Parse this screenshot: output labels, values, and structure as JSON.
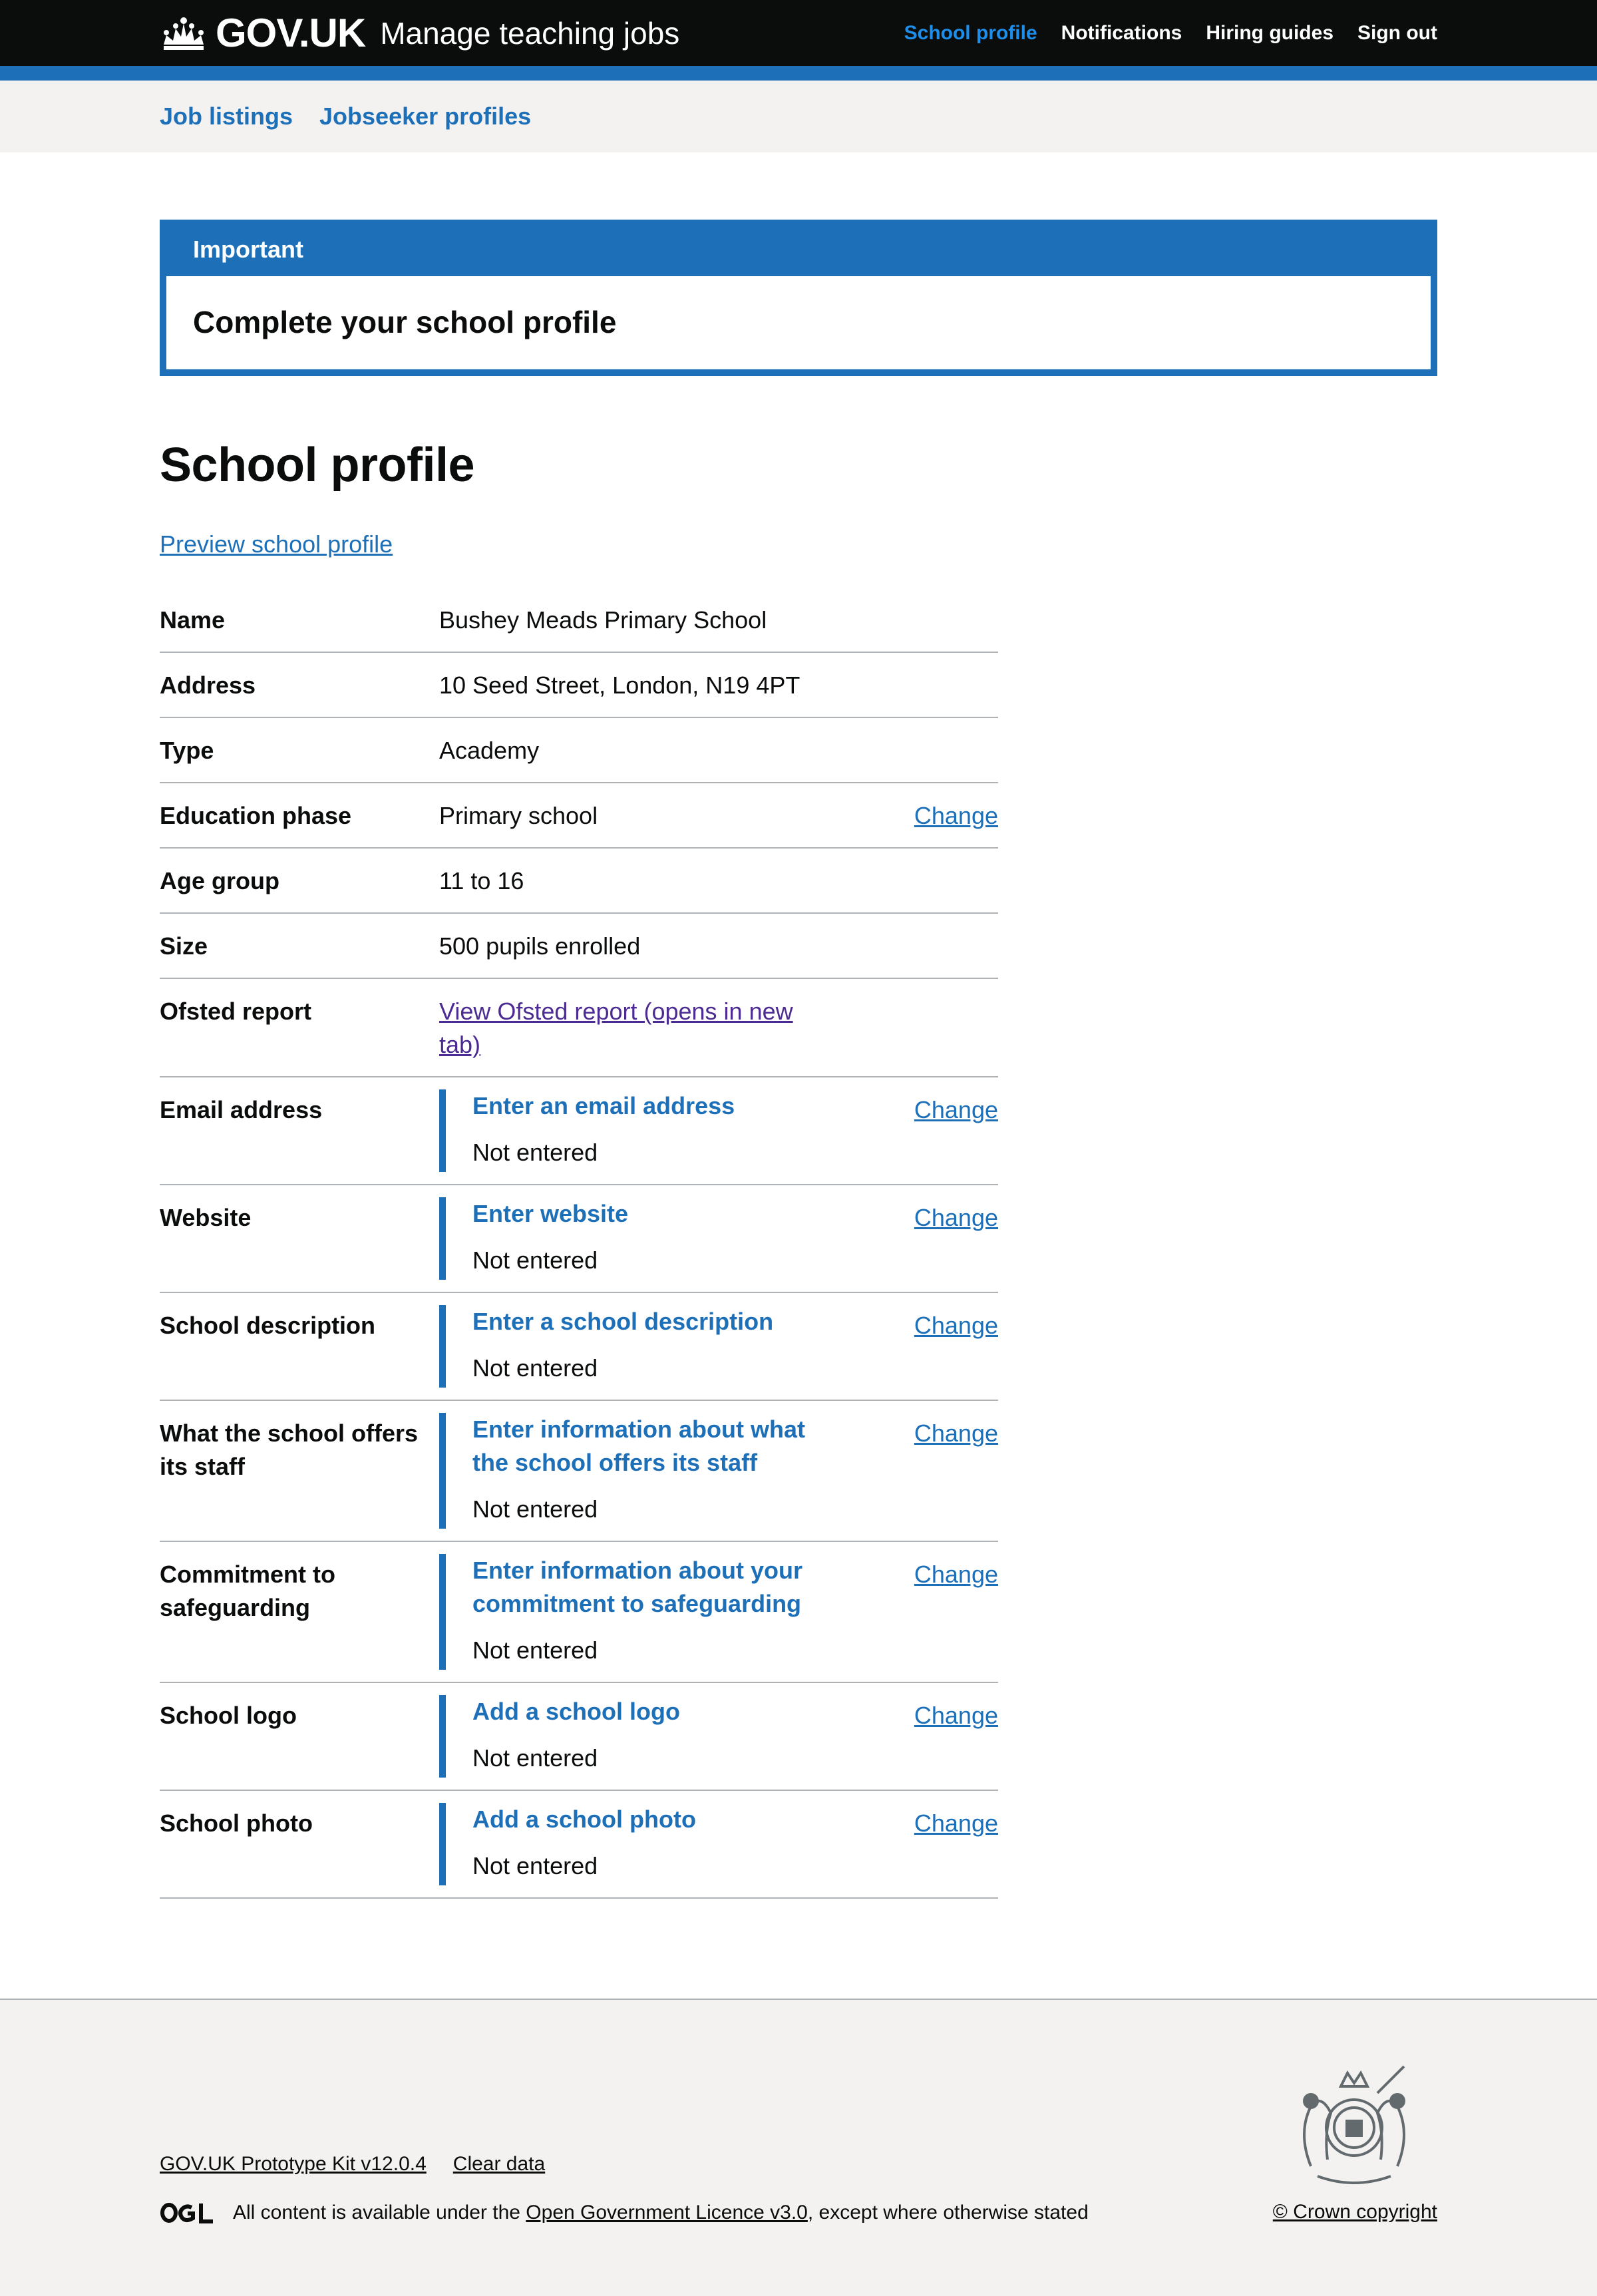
{
  "header": {
    "logo_text": "GOV.UK",
    "service_name": "Manage teaching jobs",
    "nav": [
      {
        "label": "School profile",
        "active": true
      },
      {
        "label": "Notifications"
      },
      {
        "label": "Hiring guides"
      },
      {
        "label": "Sign out"
      }
    ]
  },
  "subnav": {
    "items": [
      {
        "label": "Job listings"
      },
      {
        "label": "Jobseeker profiles"
      }
    ]
  },
  "banner": {
    "title": "Important",
    "content": "Complete your school profile"
  },
  "page": {
    "title": "School profile",
    "preview_link": "Preview school profile"
  },
  "summary": {
    "change_label": "Change",
    "rows": [
      {
        "key": "Name",
        "value": "Bushey Meads Primary School"
      },
      {
        "key": "Address",
        "value": "10 Seed Street, London, N19 4PT"
      },
      {
        "key": "Type",
        "value": "Academy"
      },
      {
        "key": "Education phase",
        "value": "Primary school"
      },
      {
        "key": "Age group",
        "value": "11 to 16"
      },
      {
        "key": "Size",
        "value": "500 pupils enrolled"
      },
      {
        "key": "Ofsted report",
        "link": "View Ofsted report (opens in new tab)"
      },
      {
        "key": "Email address",
        "task": "Enter an email address",
        "status": "Not entered"
      },
      {
        "key": "Website",
        "task": "Enter website",
        "status": "Not entered"
      },
      {
        "key": "School description",
        "task": "Enter a school description",
        "status": "Not entered"
      },
      {
        "key": "What the school offers its staff",
        "task": "Enter information about what the school offers its staff",
        "status": "Not entered"
      },
      {
        "key": "Commitment to safeguarding",
        "task": "Enter information about your commitment to safeguarding",
        "status": "Not entered"
      },
      {
        "key": "School logo",
        "task": "Add a school logo",
        "status": "Not entered"
      },
      {
        "key": "School photo",
        "task": "Add a school photo",
        "status": "Not entered"
      }
    ]
  },
  "footer": {
    "links": [
      {
        "label": "GOV.UK Prototype Kit v12.0.4"
      },
      {
        "label": "Clear data"
      }
    ],
    "licence_prefix": "All content is available under the",
    "licence_link": "Open Government Licence v3.0",
    "licence_suffix": ", except where otherwise stated",
    "copyright": "© Crown copyright"
  },
  "colors": {
    "brand_blue": "#1d70b8",
    "black": "#0b0c0c",
    "light_grey": "#f3f2f1",
    "border_grey": "#b1b4b6",
    "visited_link": "#4c2c92"
  }
}
